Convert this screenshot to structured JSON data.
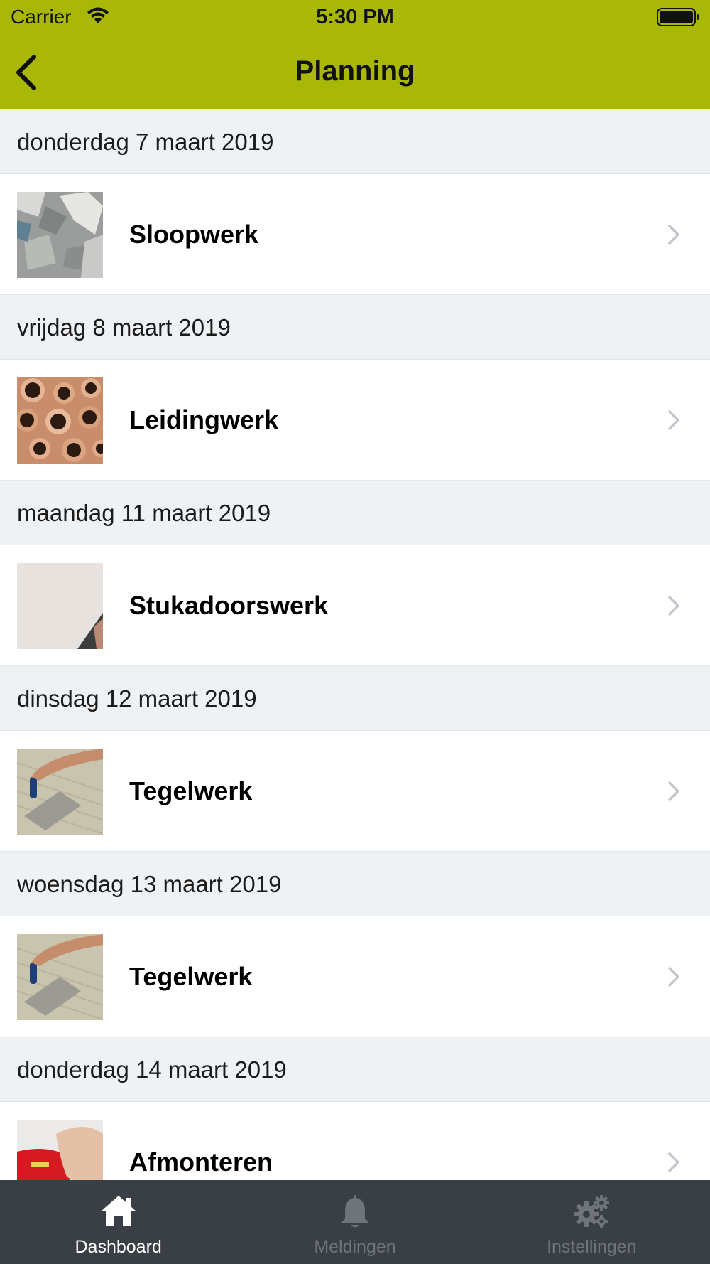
{
  "status_bar": {
    "carrier": "Carrier",
    "time": "5:30 PM"
  },
  "nav": {
    "title": "Planning",
    "back_icon": "chevron-left-icon"
  },
  "colors": {
    "accent": "#a9b806",
    "section_bg": "#eff2f5",
    "tabbar_bg": "#3a3f45",
    "tab_active": "#ffffff",
    "tab_inactive": "#6e747a"
  },
  "schedule": [
    {
      "date": "donderdag 7 maart 2019",
      "title": "Sloopwerk",
      "image": "demolition-rubble-photo"
    },
    {
      "date": "vrijdag 8 maart 2019",
      "title": "Leidingwerk",
      "image": "copper-pipes-photo"
    },
    {
      "date": "maandag 11 maart 2019",
      "title": "Stukadoorswerk",
      "image": "plaster-wall-photo"
    },
    {
      "date": "dinsdag 12 maart 2019",
      "title": "Tegelwerk",
      "image": "tile-trowel-photo"
    },
    {
      "date": "woensdag 13 maart 2019",
      "title": "Tegelwerk",
      "image": "tile-trowel-photo"
    },
    {
      "date": "donderdag 14 maart 2019",
      "title": "Afmonteren",
      "image": "hand-tool-photo"
    }
  ],
  "tabbar": {
    "active": "Dashboard",
    "tabs": [
      {
        "label": "Dashboard",
        "icon": "home-icon"
      },
      {
        "label": "Meldingen",
        "icon": "bell-icon"
      },
      {
        "label": "Instellingen",
        "icon": "gears-icon"
      }
    ]
  }
}
